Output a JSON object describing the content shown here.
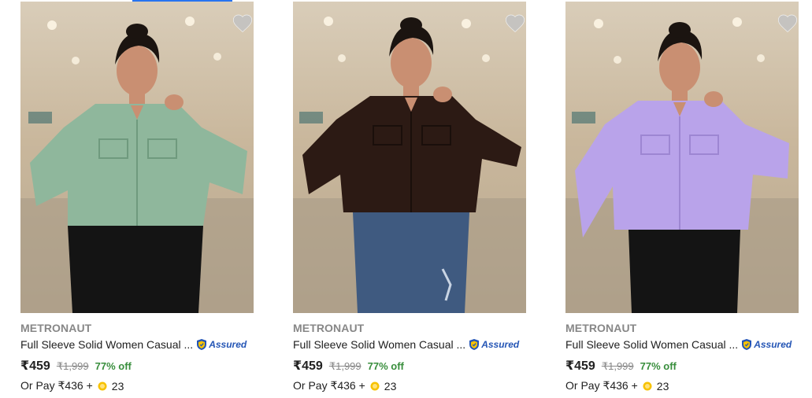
{
  "products": [
    {
      "brand": "METRONAUT",
      "title": "Full Sleeve Solid Women Casual ...",
      "assured_label": "Assured",
      "price": "₹459",
      "mrp": "₹1,999",
      "discount": "77% off",
      "pay_prefix": "Or Pay ₹436 +",
      "coins": "23",
      "jacket_color": "#8fb79c",
      "pants_color": "#141414"
    },
    {
      "brand": "METRONAUT",
      "title": "Full Sleeve Solid Women Casual ...",
      "assured_label": "Assured",
      "price": "₹459",
      "mrp": "₹1,999",
      "discount": "77% off",
      "pay_prefix": "Or Pay ₹436 +",
      "coins": "23",
      "jacket_color": "#2c1a14",
      "pants_color": "#3f5a80"
    },
    {
      "brand": "METRONAUT",
      "title": "Full Sleeve Solid Women Casual ...",
      "assured_label": "Assured",
      "price": "₹459",
      "mrp": "₹1,999",
      "discount": "77% off",
      "pay_prefix": "Or Pay ₹436 +",
      "coins": "23",
      "jacket_color": "#b9a3ea",
      "pants_color": "#141414"
    }
  ],
  "colors": {
    "accent": "#2874f0",
    "discount_green": "#388e3c",
    "muted_gray": "#878787",
    "assured_blue": "#2455b5",
    "coin_gold": "#f7c200"
  },
  "icons": {
    "wishlist": "heart-icon",
    "assured": "assured-badge-icon",
    "coin": "supercoin-icon"
  }
}
